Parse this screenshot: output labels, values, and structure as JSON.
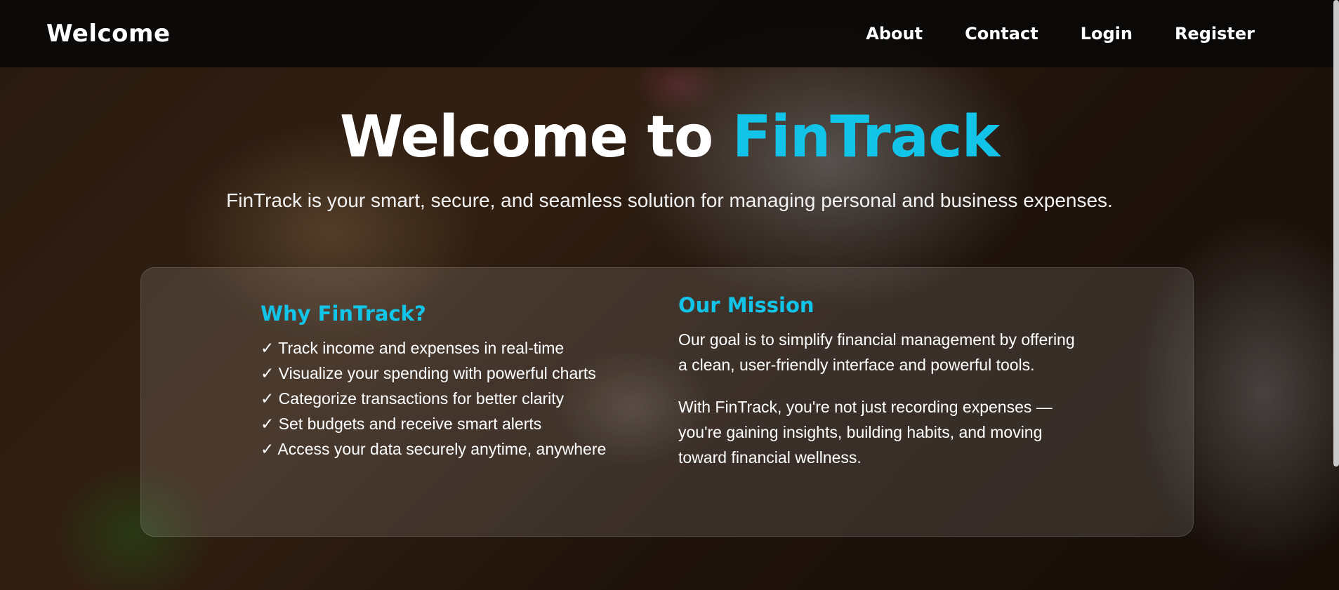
{
  "nav": {
    "brand": "Welcome",
    "links": [
      "About",
      "Contact",
      "Login",
      "Register"
    ]
  },
  "hero": {
    "title_prefix": "Welcome to ",
    "title_accent": "FinTrack",
    "subtitle": "FinTrack is your smart, secure, and seamless solution for managing personal and business expenses."
  },
  "why": {
    "heading": "Why FinTrack?",
    "items": [
      "✓ Track income and expenses in real-time",
      "✓ Visualize your spending with powerful charts",
      "✓ Categorize transactions for better clarity",
      "✓ Set budgets and receive smart alerts",
      "✓ Access your data securely anytime, anywhere"
    ]
  },
  "mission": {
    "heading": "Our Mission",
    "paragraphs": [
      "Our goal is to simplify financial management by offering a clean, user-friendly interface and powerful tools.",
      "With FinTrack, you're not just recording expenses — you're gaining insights, building habits, and moving toward financial wellness."
    ]
  },
  "colors": {
    "accent": "#12c5e8",
    "navbar": "#080808"
  }
}
